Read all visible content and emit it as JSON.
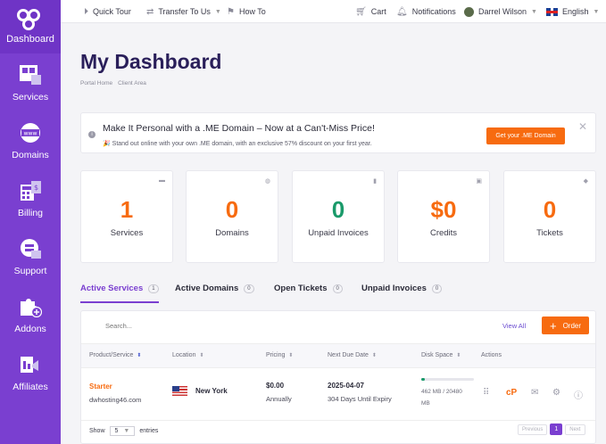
{
  "sidebar": {
    "logo_label": "Dashboard",
    "items": [
      {
        "label": "Services",
        "icon": "services-icon"
      },
      {
        "label": "Domains",
        "icon": "www-globe-icon"
      },
      {
        "label": "Billing",
        "icon": "billing-calculator-icon"
      },
      {
        "label": "Support",
        "icon": "support-ticket-icon"
      },
      {
        "label": "Addons",
        "icon": "puzzle-plus-icon"
      },
      {
        "label": "Affiliates",
        "icon": "affiliates-megaphone-icon"
      }
    ]
  },
  "topbar": {
    "quick_tour": "Quick Tour",
    "transfer": "Transfer To Us",
    "how_to": "How To",
    "cart": "Cart",
    "notifications": "Notifications",
    "user": "Darrel Wilson",
    "language": "English"
  },
  "page": {
    "title": "My Dashboard",
    "breadcrumb": [
      "Portal Home",
      "Client Area"
    ]
  },
  "promo": {
    "title": "Make It Personal with a .ME Domain – Now at a Can't-Miss Price!",
    "subtitle": "🎉 Stand out online with your own .ME domain, with an exclusive 57% discount on your first year.",
    "button": "Get your .ME Domain",
    "close": "✕"
  },
  "stats": [
    {
      "value": "1",
      "label": "Services",
      "color": "#f76b10"
    },
    {
      "value": "0",
      "label": "Domains",
      "color": "#f76b10"
    },
    {
      "value": "0",
      "label": "Unpaid Invoices",
      "color": "#1a9a6a"
    },
    {
      "value": "$0",
      "label": "Credits",
      "color": "#f76b10"
    },
    {
      "value": "0",
      "label": "Tickets",
      "color": "#f76b10"
    }
  ],
  "tabs": [
    {
      "label": "Active Services",
      "count": "1",
      "active": true
    },
    {
      "label": "Active Domains",
      "count": "0"
    },
    {
      "label": "Open Tickets",
      "count": "0"
    },
    {
      "label": "Unpaid Invoices",
      "count": "0"
    }
  ],
  "table": {
    "search_placeholder": "Search...",
    "view_all": "View All",
    "order": "Order",
    "columns": [
      "Product/Service",
      "Location",
      "Pricing",
      "Next Due Date",
      "Disk Space",
      "Actions"
    ],
    "row": {
      "product": "Starter",
      "domain": "dwhosting46.com",
      "location": "New York",
      "price": "$0.00",
      "cycle": "Annually",
      "due_date": "2025-04-07",
      "due_note": "304 Days Until Expiry",
      "disk": "462 MB / 20480 MB",
      "disk_fraction": 0.0226
    },
    "footer": {
      "show": "Show",
      "per_page": "5",
      "entries": "entries",
      "previous": "Previous",
      "page": "1",
      "next": "Next"
    }
  }
}
